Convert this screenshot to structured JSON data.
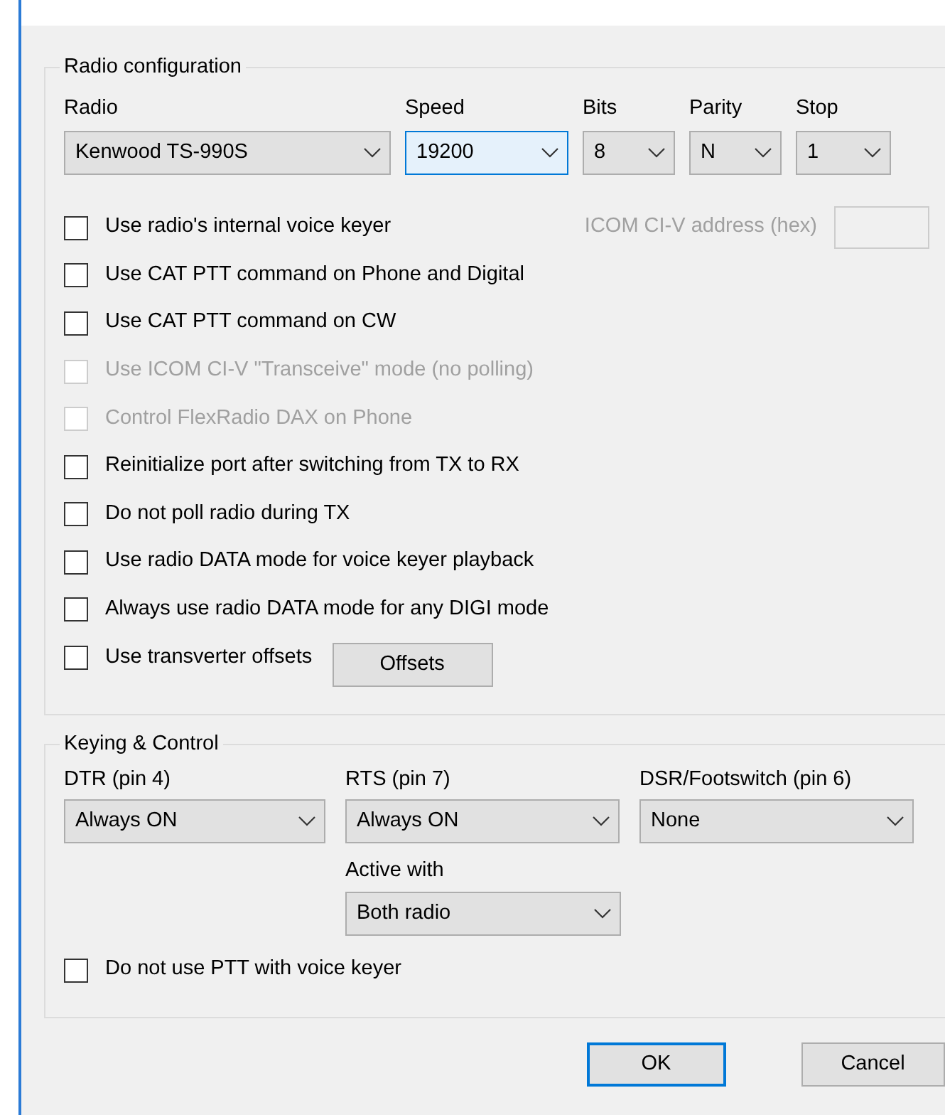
{
  "radio_configuration": {
    "title": "Radio configuration",
    "selects": [
      {
        "label": "Radio",
        "value": "Kenwood TS-990S",
        "focused": false
      },
      {
        "label": "Speed",
        "value": "19200",
        "focused": true
      },
      {
        "label": "Bits",
        "value": "8",
        "focused": false
      },
      {
        "label": "Parity",
        "value": "N",
        "focused": false
      },
      {
        "label": "Stop",
        "value": "1",
        "focused": false
      }
    ],
    "icom_address": {
      "label": "ICOM CI-V address (hex)",
      "disabled": true
    },
    "options": [
      {
        "label": "Use radio's internal voice keyer",
        "checked": false,
        "disabled": false
      },
      {
        "label": "Use CAT PTT command on Phone and Digital",
        "checked": false,
        "disabled": false
      },
      {
        "label": "Use CAT PTT command on CW",
        "checked": false,
        "disabled": false
      },
      {
        "label": "Use ICOM CI-V \"Transceive\" mode (no polling)",
        "checked": false,
        "disabled": true
      },
      {
        "label": "Control FlexRadio DAX on Phone",
        "checked": false,
        "disabled": true
      },
      {
        "label": "Reinitialize port after switching from TX to RX",
        "checked": false,
        "disabled": false
      },
      {
        "label": "Do not poll radio during TX",
        "checked": false,
        "disabled": false
      },
      {
        "label": "Use radio DATA mode for voice keyer playback",
        "checked": false,
        "disabled": false
      },
      {
        "label": "Always use radio DATA mode for any DIGI mode",
        "checked": false,
        "disabled": false
      },
      {
        "label": "Use transverter offsets",
        "checked": false,
        "disabled": false,
        "button": "Offsets"
      }
    ]
  },
  "keying_control": {
    "title": "Keying & Control",
    "selects": [
      {
        "label": "DTR (pin 4)",
        "value": "Always ON"
      },
      {
        "label": "RTS (pin 7)",
        "value": "Always ON"
      },
      {
        "label": "DSR/Footswitch (pin 6)",
        "value": "None"
      }
    ],
    "active_with": {
      "label": "Active with",
      "value": "Both radio"
    },
    "options": [
      {
        "label": "Do not use PTT with voice keyer",
        "checked": false,
        "disabled": false
      }
    ]
  },
  "buttons": [
    {
      "label": "OK",
      "default": true
    },
    {
      "label": "Cancel",
      "default": false
    }
  ]
}
